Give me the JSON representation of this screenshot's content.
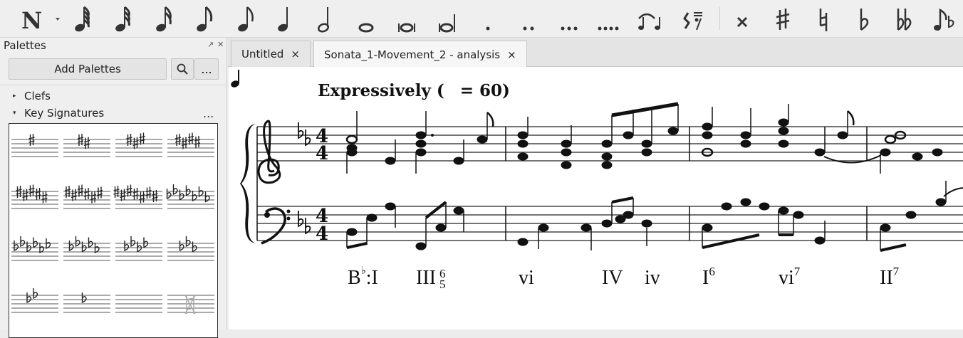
{
  "toolbar": {
    "items": [
      "note-input-n",
      "64th-note",
      "32nd-note",
      "16th-note",
      "8th-note",
      "quarter-note",
      "half-note",
      "whole-note",
      "breve",
      "longa",
      "augmentation-dot",
      "double-dot",
      "triple-dot",
      "quadruple-dot",
      "tie",
      "rest",
      "double-sharp",
      "sharp",
      "natural",
      "flat",
      "double-flat",
      "flip-direction"
    ]
  },
  "palettes": {
    "title": "Palettes",
    "add_label": "Add Palettes",
    "more_label": "...",
    "sections": [
      {
        "label": "Clefs",
        "expanded": false
      },
      {
        "label": "Key Signatures",
        "expanded": true
      }
    ],
    "key_signature_cells": [
      "1-sharp",
      "2-sharps",
      "3-sharps",
      "4-sharps",
      "5-sharps",
      "6-sharps",
      "7-sharps",
      "7-flats",
      "6-flats",
      "5-flats",
      "4-flats",
      "3-flats",
      "2-flats",
      "1-flat",
      "open-atonal",
      "cancel"
    ]
  },
  "tabs": [
    {
      "label": "Untitled",
      "active": false,
      "close": "×"
    },
    {
      "label": "Sonata_1-Movement_2 - analysis",
      "active": true,
      "close": "×"
    }
  ],
  "score": {
    "tempo_text": "Expressively (",
    "tempo_value": "= 60)",
    "analysis": [
      {
        "label": "B",
        "accidental": "♭",
        "suffix": ":I"
      },
      {
        "label": "III",
        "figures": [
          "6",
          "5"
        ]
      },
      {
        "label": "vi"
      },
      {
        "label": "IV"
      },
      {
        "label": "iv"
      },
      {
        "label": "I",
        "sup": "6"
      },
      {
        "label": "vi",
        "sup": "7"
      },
      {
        "label": "II",
        "sup": "7"
      }
    ]
  }
}
